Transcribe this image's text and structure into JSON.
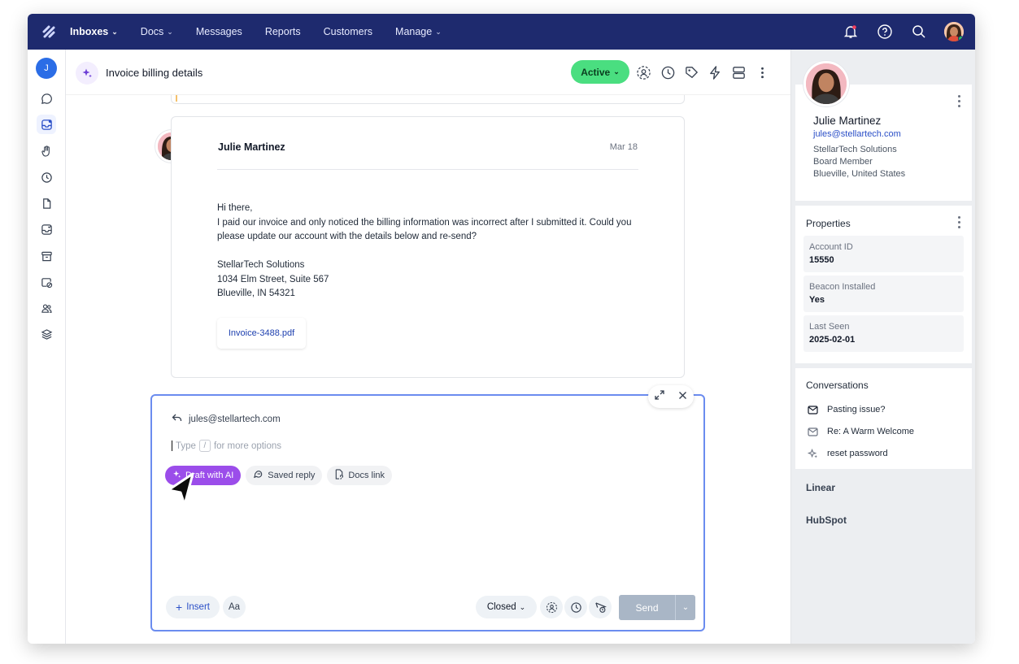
{
  "nav": {
    "items": [
      {
        "label": "Inboxes",
        "dropdown": true,
        "active": true
      },
      {
        "label": "Docs",
        "dropdown": true
      },
      {
        "label": "Messages"
      },
      {
        "label": "Reports"
      },
      {
        "label": "Customers"
      },
      {
        "label": "Manage",
        "dropdown": true
      }
    ],
    "icons": [
      "bell-icon",
      "help-icon",
      "search-icon",
      "user-avatar"
    ],
    "brand_color": "#1e2a6e"
  },
  "rail": {
    "user_initial": "J",
    "icons": [
      "chat-icon",
      "inbox-icon",
      "hand-icon",
      "clock-icon",
      "document-icon",
      "inbox-check-icon",
      "archive-icon",
      "spam-icon",
      "team-icon",
      "layers-icon"
    ]
  },
  "conversation": {
    "title": "Invoice billing details",
    "status": "Active",
    "status_color": "#4ade80"
  },
  "message": {
    "sender": "Julie Martinez",
    "date": "Mar 18",
    "greeting": "Hi there,",
    "paragraph": "I paid our invoice and only noticed the billing information was  incorrect after I submitted it. Could you please update our account with the details below and re-send?",
    "address_line1": "StellarTech Solutions",
    "address_line2": "1034 Elm Street, Suite 567",
    "address_line3": "Blueville, IN 54321",
    "attachment": "Invoice-3488.pdf"
  },
  "composer": {
    "reply_to": "jules@stellartech.com",
    "placeholder_pre": "Type",
    "placeholder_key": "/",
    "placeholder_post": "for more options",
    "chips": {
      "ai": "Draft with AI",
      "saved": "Saved reply",
      "docs": "Docs link"
    },
    "insert_label": "Insert",
    "format_label": "Aa",
    "status_label": "Closed",
    "send_label": "Send"
  },
  "customer": {
    "name": "Julie Martinez",
    "email": "jules@stellartech.com",
    "company": "StellarTech Solutions",
    "role": "Board Member",
    "location": "Blueville, United States"
  },
  "properties": {
    "heading": "Properties",
    "items": [
      {
        "key": "Account ID",
        "value": "15550"
      },
      {
        "key": "Beacon Installed",
        "value": "Yes"
      },
      {
        "key": "Last Seen",
        "value": "2025-02-01"
      }
    ]
  },
  "conversations": {
    "heading": "Conversations",
    "items": [
      {
        "label": "Pasting issue?",
        "icon": "mail-icon"
      },
      {
        "label": "Re: A Warm Welcome",
        "icon": "mail-icon"
      },
      {
        "label": "reset password",
        "icon": "sparkle-icon"
      }
    ]
  },
  "apps": [
    "Linear",
    "HubSpot"
  ]
}
